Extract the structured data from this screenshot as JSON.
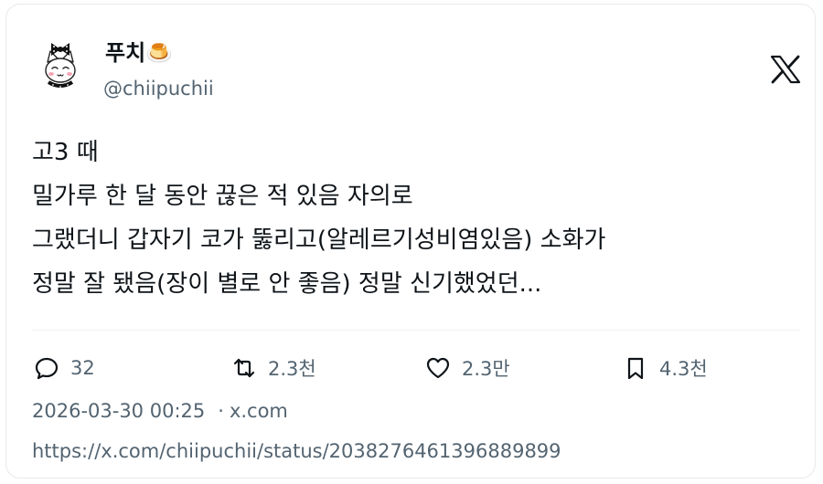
{
  "author": {
    "display_name": "푸치🍮",
    "handle": "@chiipuchii"
  },
  "tweet": {
    "lines": [
      "고3 때",
      "밀가루 한 달 동안 끊은 적 있음 자의로",
      "그랬더니 갑자기 코가 뚫리고(알레르기성비염있음) 소화가",
      "정말 잘 됐음(장이 별로 안 좋음) 정말 신기했었던..."
    ]
  },
  "actions": {
    "reply_count": "32",
    "retweet_count": "2.3천",
    "like_count": "2.3만",
    "bookmark_count": "4.3천"
  },
  "meta": {
    "timestamp": "2026-03-30 00:25",
    "separator": "·",
    "source": "x.com",
    "url": "https://x.com/chiipuchii/status/2038276461396889899"
  },
  "icons": {
    "reply": "comment-bubble-icon",
    "retweet": "retweet-arrows-icon",
    "like": "heart-icon",
    "bookmark": "bookmark-icon",
    "brand": "x-logo-icon",
    "avatar": "cat-with-bow-avatar"
  },
  "colors": {
    "text_primary": "#0f1419",
    "text_secondary": "#536471",
    "border": "#e6e9ec"
  }
}
